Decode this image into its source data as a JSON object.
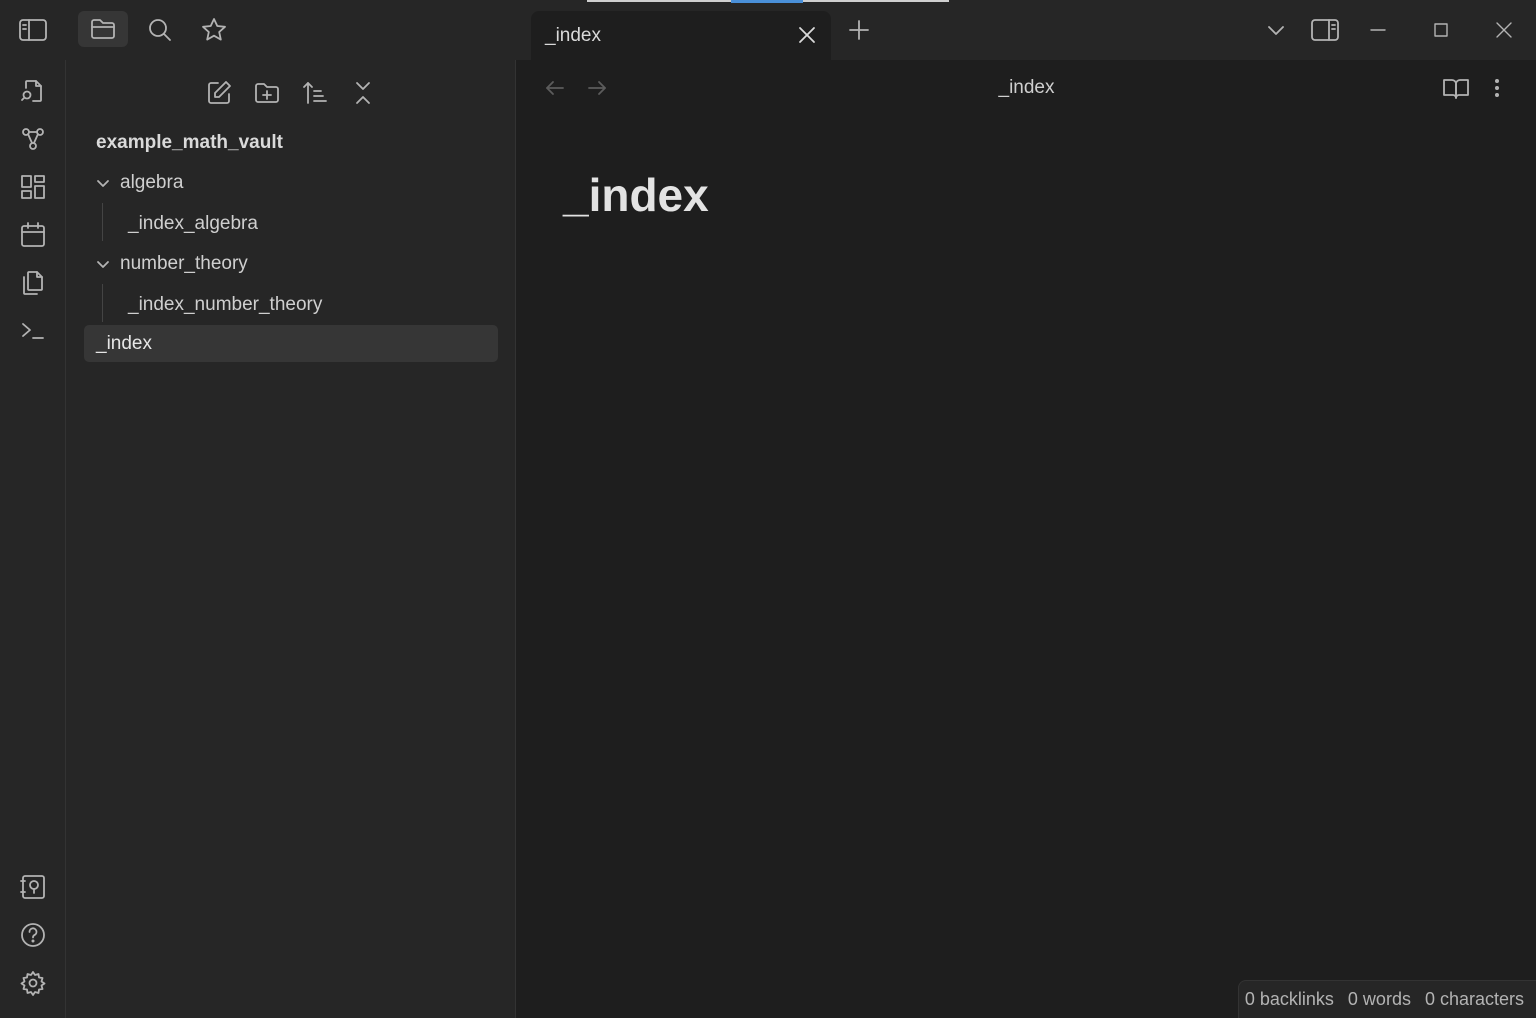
{
  "tab": {
    "title": "_index"
  },
  "file_explorer": {
    "vault_name": "example_math_vault",
    "tree": [
      {
        "label": "algebra",
        "type": "folder",
        "expanded": true
      },
      {
        "label": "_index_algebra",
        "type": "file"
      },
      {
        "label": "number_theory",
        "type": "folder",
        "expanded": true
      },
      {
        "label": "_index_number_theory",
        "type": "file"
      },
      {
        "label": "_index",
        "type": "file",
        "selected": true
      }
    ]
  },
  "view": {
    "header_title": "_index",
    "heading": "_index"
  },
  "status_bar": {
    "backlinks": "0 backlinks",
    "words": "0 words",
    "characters": "0 characters"
  },
  "colors": {
    "background": "#1e1e1e",
    "panel": "#262626",
    "selection": "#363636",
    "accent": "#4a90d9"
  }
}
